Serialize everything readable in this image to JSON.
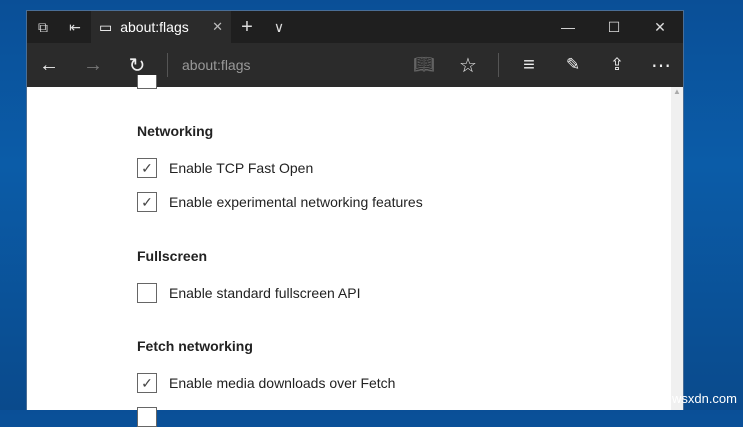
{
  "tabbar": {
    "tab_title": "about:flags",
    "close": "✕",
    "new_tab": "+",
    "tab_list": "∨",
    "min": "—",
    "max": "☐",
    "close_win": "✕"
  },
  "navbar": {
    "address": "about:flags"
  },
  "sections": [
    {
      "title": "Networking",
      "items": [
        {
          "label": "Enable TCP Fast Open",
          "checked": true
        },
        {
          "label": "Enable experimental networking features",
          "checked": true
        }
      ]
    },
    {
      "title": "Fullscreen",
      "items": [
        {
          "label": "Enable standard fullscreen API",
          "checked": false
        }
      ]
    },
    {
      "title": "Fetch networking",
      "items": [
        {
          "label": "Enable media downloads over Fetch",
          "checked": true
        }
      ]
    }
  ],
  "watermark": "wsxdn.com"
}
